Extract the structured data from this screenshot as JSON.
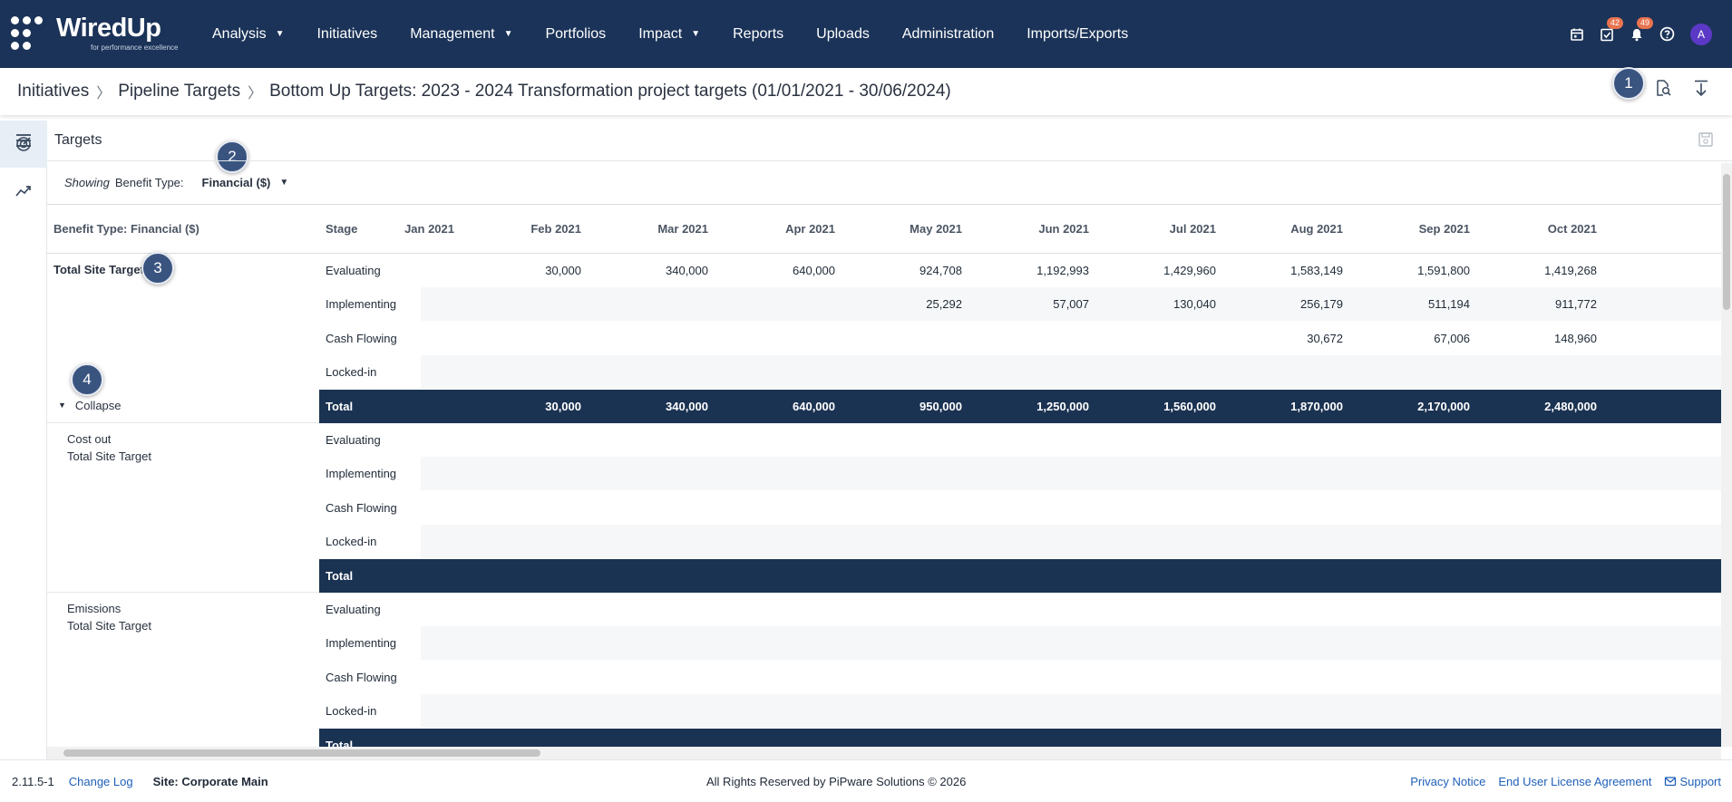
{
  "app": {
    "logo_word": "WiredUp",
    "logo_tagline": "for performance excellence"
  },
  "nav": {
    "items": [
      {
        "label": "Analysis",
        "dropdown": true
      },
      {
        "label": "Initiatives",
        "dropdown": false
      },
      {
        "label": "Management",
        "dropdown": true
      },
      {
        "label": "Portfolios",
        "dropdown": false
      },
      {
        "label": "Impact",
        "dropdown": true
      },
      {
        "label": "Reports",
        "dropdown": false
      },
      {
        "label": "Uploads",
        "dropdown": false
      },
      {
        "label": "Administration",
        "dropdown": false
      },
      {
        "label": "Imports/Exports",
        "dropdown": false
      }
    ],
    "icons": [
      "calendar-icon",
      "task-check-icon",
      "bell-icon",
      "help-icon"
    ],
    "tasks_badge": "42",
    "notifications_badge": "49",
    "avatar_initial": "A"
  },
  "breadcrumb": {
    "items": [
      "Initiatives",
      "Pipeline Targets",
      "Bottom Up Targets: 2023 - 2024 Transformation project targets (01/01/2021 - 30/06/2024)"
    ]
  },
  "markers": [
    "1",
    "2",
    "3",
    "4"
  ],
  "panel": {
    "title": "Targets",
    "showing_label": "Showing",
    "benefit_type_label": "Benefit Type:",
    "benefit_type_value": "Financial ($)"
  },
  "grid": {
    "first_col_header": "Benefit Type: Financial ($)",
    "stage_header": "Stage",
    "months": [
      "Jan 2021",
      "Feb 2021",
      "Mar 2021",
      "Apr 2021",
      "May 2021",
      "Jun 2021",
      "Jul 2021",
      "Aug 2021",
      "Sep 2021",
      "Oct 2021"
    ],
    "collapse_label": "Collapse",
    "groups": [
      {
        "label": [
          "Total Site Target"
        ],
        "bold": true,
        "rows": [
          {
            "stage": "Evaluating",
            "values": [
              "",
              "30,000",
              "340,000",
              "640,000",
              "924,708",
              "1,192,993",
              "1,429,960",
              "1,583,149",
              "1,591,800",
              "1,419,268"
            ]
          },
          {
            "stage": "Implementing",
            "values": [
              "",
              "",
              "",
              "",
              "25,292",
              "57,007",
              "130,040",
              "256,179",
              "511,194",
              "911,772"
            ]
          },
          {
            "stage": "Cash Flowing",
            "values": [
              "",
              "",
              "",
              "",
              "",
              "",
              "",
              "30,672",
              "67,006",
              "148,960"
            ]
          },
          {
            "stage": "Locked-in",
            "values": [
              "",
              "",
              "",
              "",
              "",
              "",
              "",
              "",
              "",
              ""
            ]
          },
          {
            "stage": "Total",
            "values": [
              "",
              "30,000",
              "340,000",
              "640,000",
              "950,000",
              "1,250,000",
              "1,560,000",
              "1,870,000",
              "2,170,000",
              "2,480,000"
            ]
          }
        ]
      },
      {
        "label": [
          "Cost out",
          "Total Site Target"
        ],
        "bold": false,
        "rows": [
          {
            "stage": "Evaluating",
            "values": []
          },
          {
            "stage": "Implementing",
            "values": []
          },
          {
            "stage": "Cash Flowing",
            "values": []
          },
          {
            "stage": "Locked-in",
            "values": []
          },
          {
            "stage": "Total",
            "values": []
          }
        ]
      },
      {
        "label": [
          "Emissions",
          "Total Site Target"
        ],
        "bold": false,
        "rows": [
          {
            "stage": "Evaluating",
            "values": []
          },
          {
            "stage": "Implementing",
            "values": []
          },
          {
            "stage": "Cash Flowing",
            "values": []
          },
          {
            "stage": "Locked-in",
            "values": []
          },
          {
            "stage": "Total",
            "values": []
          }
        ]
      }
    ]
  },
  "footer": {
    "version": "2.11.5-1",
    "change_log": "Change Log",
    "site": "Site: Corporate Main",
    "rights": "All Rights Reserved by PiPware Solutions © 2026",
    "privacy": "Privacy Notice",
    "eula": "End User License Agreement",
    "support": "Support"
  },
  "colors": {
    "nav_bg": "#1b3358",
    "total_row_bg": "#1b3352",
    "marker_bg": "#3a5480",
    "link": "#1f5fb8",
    "badge": "#e8734f",
    "avatar": "#5b39c6"
  }
}
